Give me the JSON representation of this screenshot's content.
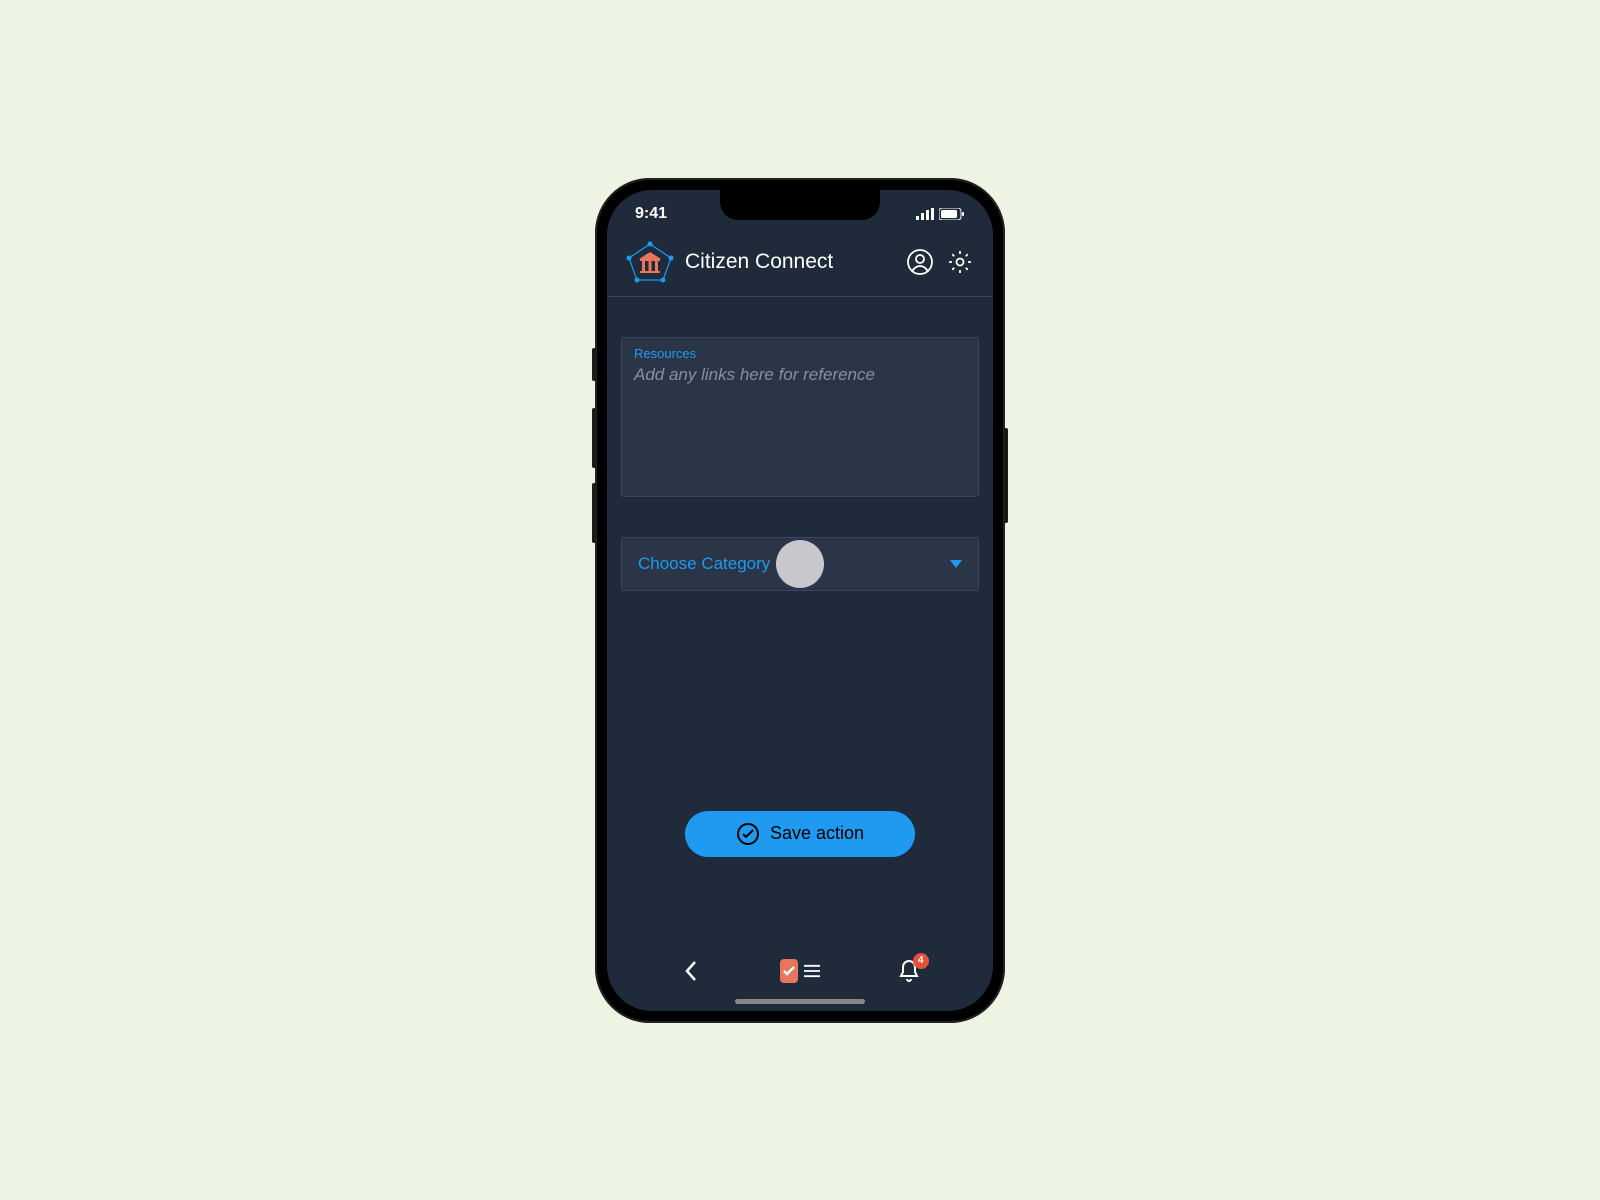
{
  "status": {
    "time": "9:41"
  },
  "header": {
    "title": "Citizen Connect"
  },
  "resources": {
    "label": "Resources",
    "placeholder": "Add any links here for reference"
  },
  "category": {
    "label": "Choose Category"
  },
  "save": {
    "label": "Save action"
  },
  "notifications": {
    "count": "4"
  }
}
